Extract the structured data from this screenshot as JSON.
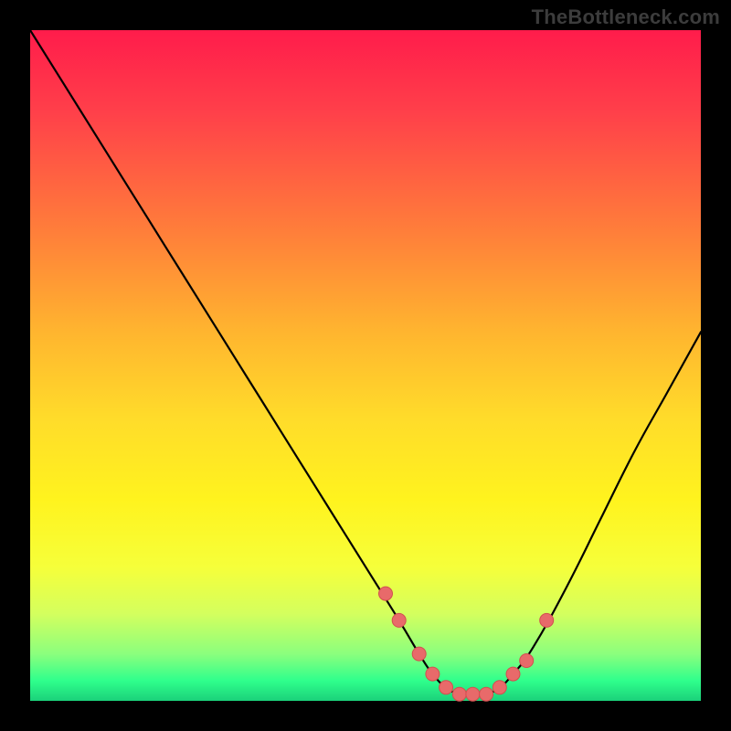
{
  "watermark": "TheBottleneck.com",
  "colors": {
    "curve_stroke": "#000000",
    "marker_fill": "#e86a6a",
    "marker_stroke": "#d24f4f"
  },
  "chart_data": {
    "type": "line",
    "title": "",
    "xlabel": "",
    "ylabel": "",
    "xlim": [
      0,
      100
    ],
    "ylim": [
      0,
      100
    ],
    "grid": false,
    "legend": false,
    "series": [
      {
        "name": "bottleneck-curve",
        "x": [
          0,
          5,
          10,
          15,
          20,
          25,
          30,
          35,
          40,
          45,
          50,
          55,
          58,
          60,
          62,
          64,
          66,
          68,
          70,
          72,
          75,
          80,
          85,
          90,
          95,
          100
        ],
        "values": [
          100,
          92,
          84,
          76,
          68,
          60,
          52,
          44,
          36,
          28,
          20,
          12,
          7,
          4,
          2,
          1,
          1,
          1,
          2,
          4,
          8,
          17,
          27,
          37,
          46,
          55
        ]
      }
    ],
    "markers": {
      "name": "highlight-points",
      "x": [
        53,
        55,
        58,
        60,
        62,
        64,
        66,
        68,
        70,
        72,
        74,
        77
      ],
      "values": [
        16,
        12,
        7,
        4,
        2,
        1,
        1,
        1,
        2,
        4,
        6,
        12
      ]
    }
  }
}
